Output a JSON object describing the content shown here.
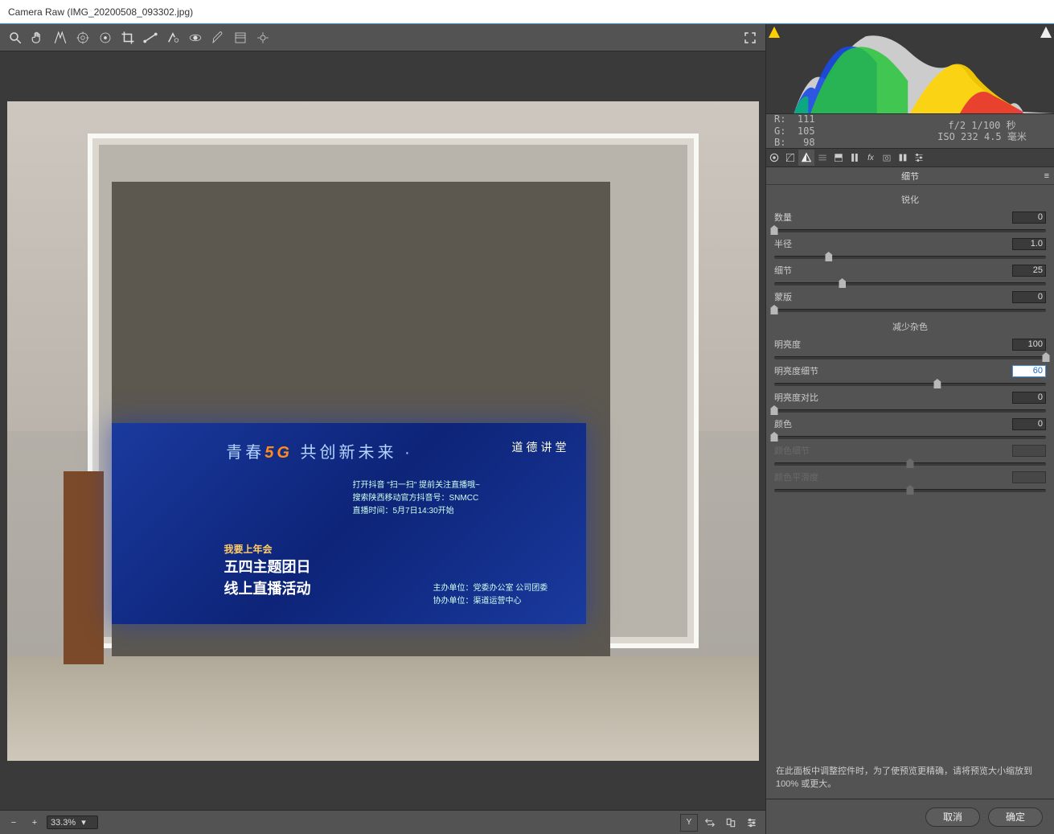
{
  "window_title": "Camera Raw (IMG_20200508_093302.jpg)",
  "toolbar_icons": [
    "zoom",
    "hand",
    "white-balance",
    "color-sampler",
    "target-adjust",
    "crop",
    "straighten",
    "spot-removal",
    "redeye",
    "adjustment-brush",
    "graduated-filter",
    "radial-filter",
    "rotate-ccw",
    "rotate-cw"
  ],
  "fullscreen_icon": "fullscreen",
  "zoom": {
    "minus": "−",
    "plus": "+",
    "value": "33.3%",
    "dropdown": "▾"
  },
  "bottom_right_icons": [
    "Y",
    "swap",
    "snapshot",
    "settings"
  ],
  "readout": {
    "R": "111",
    "G": "105",
    "B": "98",
    "R_label": "R:",
    "G_label": "G:",
    "B_label": "B:",
    "aperture_shutter": "f/2  1/100 秒",
    "iso_focal": "ISO 232  4.5 毫米"
  },
  "panel_tabs": [
    "basic",
    "curve",
    "detail",
    "hsl",
    "split",
    "lens",
    "fx",
    "calib",
    "presets",
    "snapshots"
  ],
  "panel_title": "细节",
  "sections": {
    "sharpen": "锐化",
    "noise": "减少杂色"
  },
  "sliders": {
    "amount": {
      "label": "数量",
      "value": "0",
      "pos": 0,
      "disabled": false
    },
    "radius": {
      "label": "半径",
      "value": "1.0",
      "pos": 20,
      "disabled": false
    },
    "detail": {
      "label": "细节",
      "value": "25",
      "pos": 25,
      "disabled": false
    },
    "masking": {
      "label": "蒙版",
      "value": "0",
      "pos": 0,
      "disabled": false
    },
    "luminance": {
      "label": "明亮度",
      "value": "100",
      "pos": 100,
      "disabled": false
    },
    "lum_detail": {
      "label": "明亮度细节",
      "value": "60",
      "pos": 60,
      "disabled": false,
      "active": true
    },
    "lum_contrast": {
      "label": "明亮度对比",
      "value": "0",
      "pos": 0,
      "disabled": false
    },
    "color": {
      "label": "颜色",
      "value": "0",
      "pos": 0,
      "disabled": false
    },
    "color_detail": {
      "label": "颜色细节",
      "value": "",
      "pos": 50,
      "disabled": true
    },
    "color_smooth": {
      "label": "颜色平滑度",
      "value": "",
      "pos": 50,
      "disabled": true
    }
  },
  "help_text": "在此面板中调整控件时，为了使预览更精确，请将预览大小缩放到 100% 或更大。",
  "buttons": {
    "cancel": "取消",
    "ok": "确定"
  },
  "preview": {
    "headline_pre": "青春",
    "headline_post": " 共创新未来 ·",
    "g5": "5G",
    "sub1": "我要上年会",
    "sub2": "五四主题团日",
    "sub3": "线上直播活动",
    "org1": "主办单位：党委办公室  公司团委",
    "org2": "协办单位：渠道运营中心",
    "txt1": "打开抖音 \"扫一扫\"    提前关注直播哦~",
    "txt2": "搜索陕西移动官方抖音号：SNMCC",
    "txt3": "直播时间：5月7日14:30开始",
    "lecture": "道德讲堂"
  }
}
